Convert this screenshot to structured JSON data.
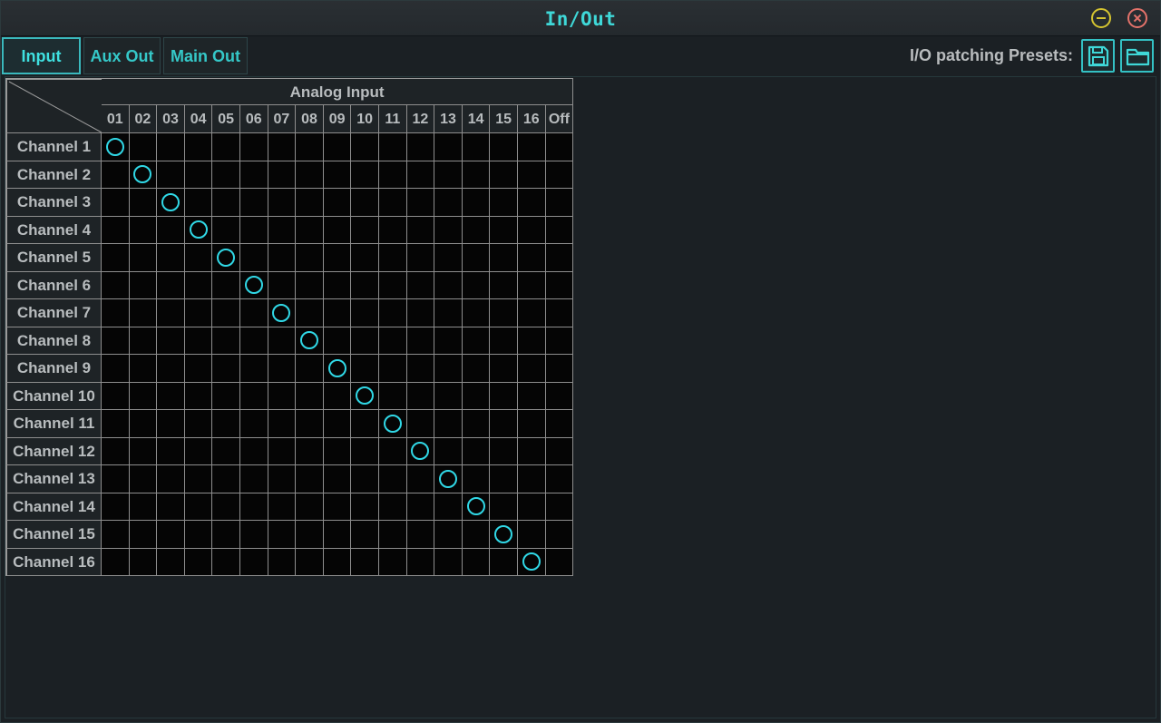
{
  "window": {
    "title": "In/Out"
  },
  "tabs": [
    {
      "label": "Input",
      "active": true
    },
    {
      "label": "Aux Out",
      "active": false
    },
    {
      "label": "Main Out",
      "active": false
    }
  ],
  "presets": {
    "label": "I/O patching Presets:",
    "save_icon": "floppy-disk-icon",
    "open_icon": "folder-icon"
  },
  "matrix": {
    "group_header": "Analog Input",
    "columns": [
      "01",
      "02",
      "03",
      "04",
      "05",
      "06",
      "07",
      "08",
      "09",
      "10",
      "11",
      "12",
      "13",
      "14",
      "15",
      "16",
      "Off"
    ],
    "rows": [
      "Channel 1",
      "Channel 2",
      "Channel 3",
      "Channel 4",
      "Channel 5",
      "Channel 6",
      "Channel 7",
      "Channel 8",
      "Channel 9",
      "Channel 10",
      "Channel 11",
      "Channel 12",
      "Channel 13",
      "Channel 14",
      "Channel 15",
      "Channel 16"
    ],
    "patched": [
      {
        "row": "Channel 1",
        "column": "01"
      },
      {
        "row": "Channel 2",
        "column": "02"
      },
      {
        "row": "Channel 3",
        "column": "03"
      },
      {
        "row": "Channel 4",
        "column": "04"
      },
      {
        "row": "Channel 5",
        "column": "05"
      },
      {
        "row": "Channel 6",
        "column": "06"
      },
      {
        "row": "Channel 7",
        "column": "07"
      },
      {
        "row": "Channel 8",
        "column": "08"
      },
      {
        "row": "Channel 9",
        "column": "09"
      },
      {
        "row": "Channel 10",
        "column": "10"
      },
      {
        "row": "Channel 11",
        "column": "11"
      },
      {
        "row": "Channel 12",
        "column": "12"
      },
      {
        "row": "Channel 13",
        "column": "13"
      },
      {
        "row": "Channel 14",
        "column": "14"
      },
      {
        "row": "Channel 15",
        "column": "15"
      },
      {
        "row": "Channel 16",
        "column": "16"
      }
    ]
  },
  "colors": {
    "accent": "#3fd8d8",
    "marker": "#30d8e6",
    "minimize": "#d6c530",
    "close": "#e3726a"
  }
}
